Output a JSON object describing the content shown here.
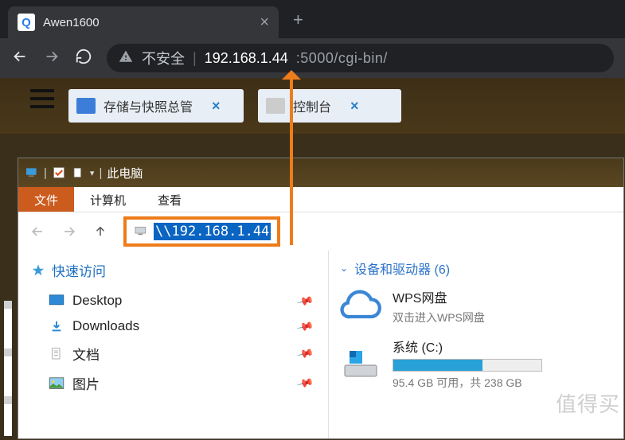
{
  "browser": {
    "tab_title": "Awen1600",
    "tab_icon_letter": "Q",
    "security_text": "不安全",
    "url_ip": "192.168.1.44",
    "url_port_path": ":5000/cgi-bin/"
  },
  "app": {
    "tabs": [
      {
        "label": "存储与快照总管"
      },
      {
        "label": "控制台"
      }
    ]
  },
  "explorer": {
    "title": "此电脑",
    "menu": {
      "file": "文件",
      "computer": "计算机",
      "view": "查看"
    },
    "address_value": "\\\\192.168.1.44",
    "sidebar": {
      "quick_access": "快速访问",
      "items": [
        {
          "label": "Desktop"
        },
        {
          "label": "Downloads"
        },
        {
          "label": "文档"
        },
        {
          "label": "图片"
        }
      ]
    },
    "content": {
      "group_header": "设备和驱动器  (6)",
      "devices": [
        {
          "name": "WPS网盘",
          "sub": "双击进入WPS网盘"
        },
        {
          "name": "系统 (C:)",
          "used_pct": 60,
          "sub": "95.4 GB 可用，共 238 GB"
        }
      ]
    }
  },
  "watermark": "值得买"
}
